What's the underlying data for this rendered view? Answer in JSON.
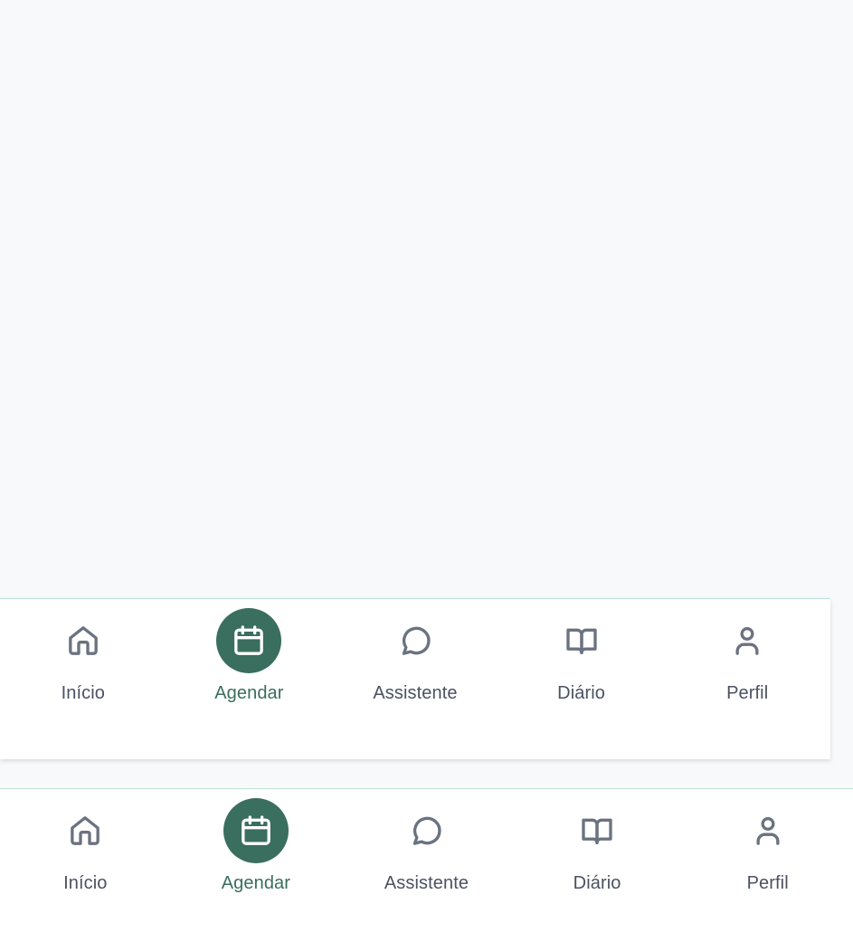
{
  "colors": {
    "background": "#f8f9fb",
    "accent": "#3a6e5e",
    "inactive_icon": "#6b7280",
    "inactive_label": "#4b5160",
    "nav_border": "#bfe3d5"
  },
  "nav_primary": {
    "items": [
      {
        "label": "Início",
        "icon": "home-icon",
        "active": false
      },
      {
        "label": "Agendar",
        "icon": "calendar-icon",
        "active": true
      },
      {
        "label": "Assistente",
        "icon": "chat-bubble-icon",
        "active": false
      },
      {
        "label": "Diário",
        "icon": "book-open-icon",
        "active": false
      },
      {
        "label": "Perfil",
        "icon": "user-icon",
        "active": false
      }
    ]
  },
  "nav_secondary": {
    "items": [
      {
        "label": "Início",
        "icon": "home-icon",
        "active": false
      },
      {
        "label": "Agendar",
        "icon": "calendar-icon",
        "active": true
      },
      {
        "label": "Assistente",
        "icon": "chat-bubble-icon",
        "active": false
      },
      {
        "label": "Diário",
        "icon": "book-open-icon",
        "active": false
      },
      {
        "label": "Perfil",
        "icon": "user-icon",
        "active": false
      }
    ]
  }
}
